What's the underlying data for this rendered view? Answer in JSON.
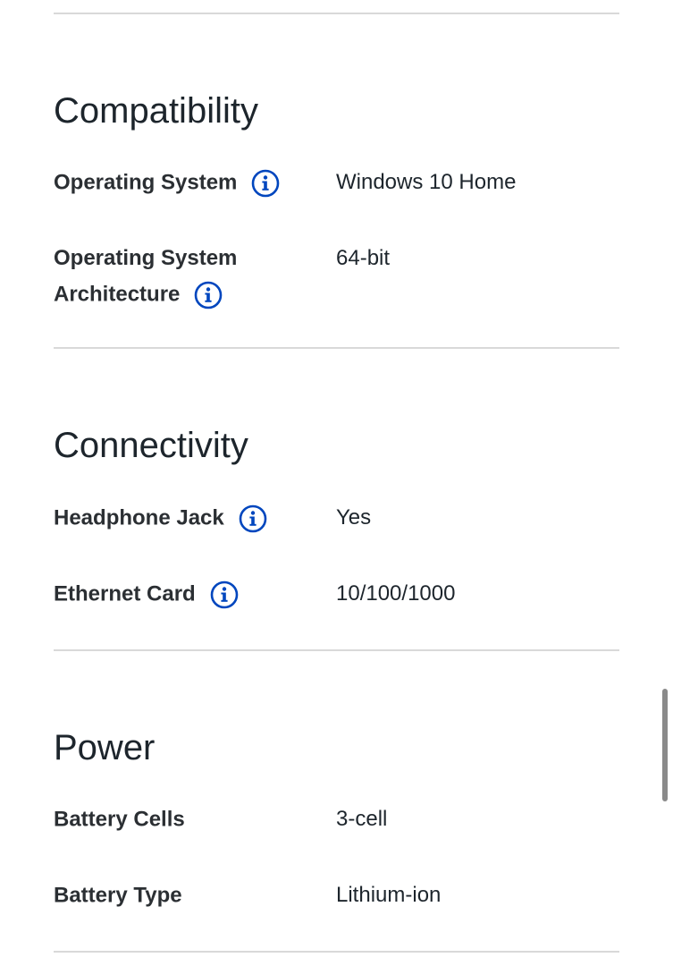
{
  "sections": [
    {
      "title": "Compatibility",
      "specs": [
        {
          "label": "Operating System",
          "value": "Windows 10 Home",
          "has_info": true
        },
        {
          "label_line1": "Operating System",
          "label_line2": "Architecture",
          "value": "64-bit",
          "has_info": true
        }
      ]
    },
    {
      "title": "Connectivity",
      "specs": [
        {
          "label": "Headphone Jack",
          "value": "Yes",
          "has_info": true
        },
        {
          "label": "Ethernet Card",
          "value": "10/100/1000",
          "has_info": true
        }
      ]
    },
    {
      "title": "Power",
      "specs": [
        {
          "label": "Battery Cells",
          "value": "3-cell",
          "has_info": false
        },
        {
          "label": "Battery Type",
          "value": "Lithium-ion",
          "has_info": false
        }
      ]
    }
  ],
  "icons": {
    "info": "info-circle-icon"
  },
  "colors": {
    "accent": "#0046be",
    "divider": "#d9d9d9",
    "text": "#1d252c"
  }
}
